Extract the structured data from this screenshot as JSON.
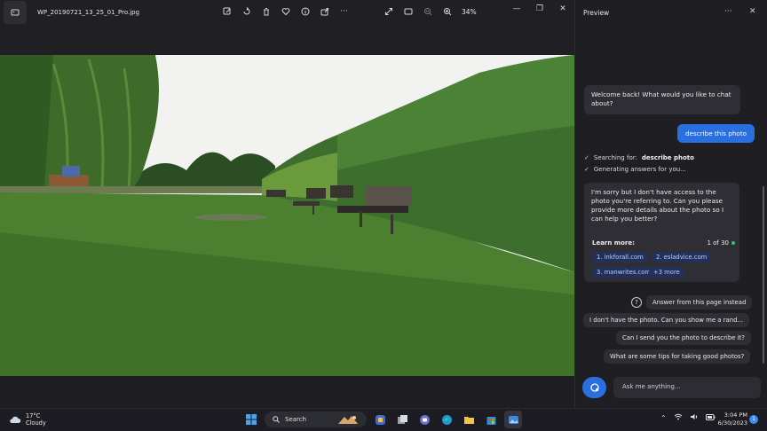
{
  "photos": {
    "filename": "WP_20190721_13_25_01_Pro.jpg",
    "zoom": "34%",
    "toolbar_icons": [
      "edit-icon",
      "rotate-icon",
      "delete-icon",
      "favorite-icon",
      "info-icon",
      "share-icon",
      "more-icon"
    ],
    "view_icons": [
      "fullscreen-icon",
      "fit-icon",
      "zoom-out-icon",
      "zoom-in-icon"
    ]
  },
  "pane": {
    "title": "Preview",
    "messages": {
      "welcome": "Welcome back! What would you like to chat about?",
      "user": "describe this photo",
      "status_searching_prefix": "Searching for:",
      "status_searching_term": "describe photo",
      "status_generating": "Generating answers for you...",
      "reply": "I'm sorry but I don't have access to the photo you're referring to. Can you please provide more details about the photo so I can help you better?"
    },
    "learn_more": {
      "heading": "Learn more:",
      "count": "1 of 30",
      "links": [
        "1. inkforall.com",
        "2. esladvice.com",
        "3. manwrites.com",
        "+3 more"
      ]
    },
    "suggestions": [
      "Answer from this page instead",
      "I don't have the photo. Can you show me a rand...",
      "Can I send you the photo to describe it?",
      "What are some tips for taking good photos?"
    ],
    "composer_placeholder": "Ask me anything..."
  },
  "taskbar": {
    "temperature": "17°C",
    "condition": "Cloudy",
    "search_label": "Search",
    "time": "3:04 PM",
    "date": "6/30/2023",
    "notification_count": "1"
  },
  "colors": {
    "accent": "#2a6fe0",
    "pane_bg": "#1f1e23",
    "chip_bg": "#23315a",
    "chip_text": "#b9cdfd"
  }
}
